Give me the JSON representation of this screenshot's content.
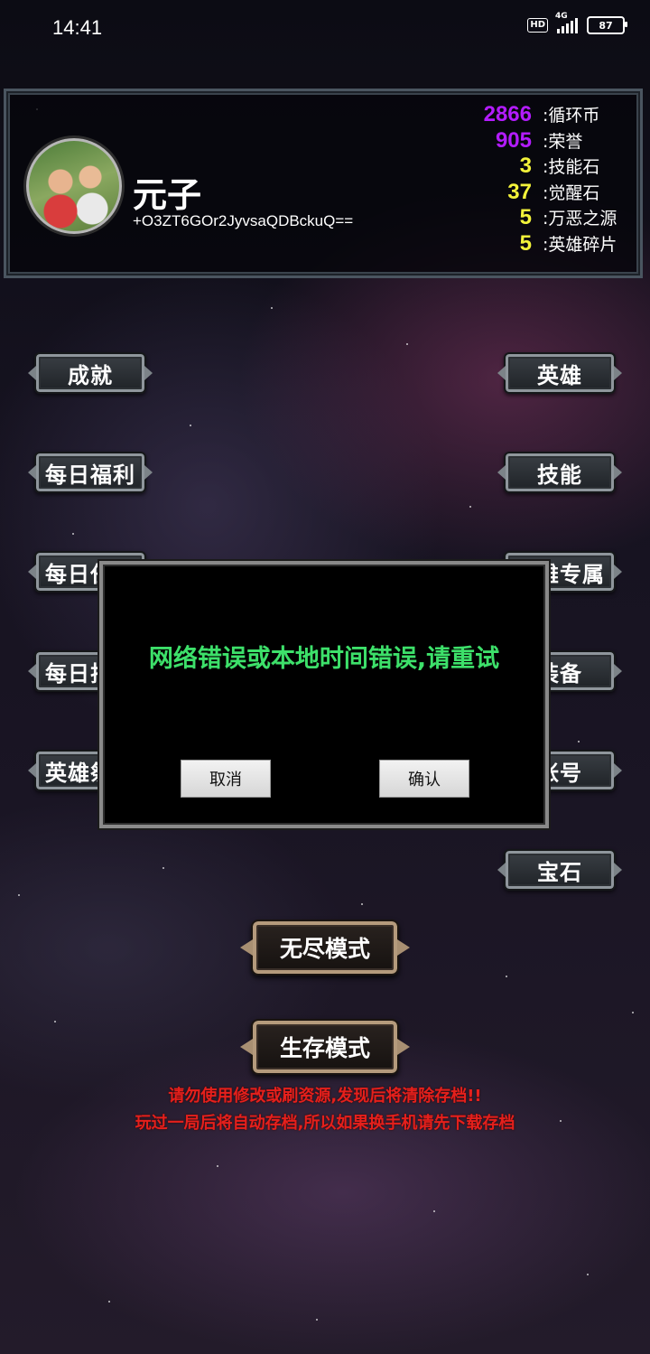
{
  "status_bar": {
    "time": "14:41",
    "hd_label": "HD",
    "network_label": "4G",
    "battery": "87"
  },
  "profile": {
    "name": "元子",
    "id": "+O3ZT6GOr2JyvsaQDBckuQ==",
    "resources": [
      {
        "value": "2866",
        "label": ":循环币",
        "color": "#b31cff"
      },
      {
        "value": "905",
        "label": ":荣誉",
        "color": "#b31cff"
      },
      {
        "value": "3",
        "label": ":技能石",
        "color": "#f3f33a"
      },
      {
        "value": "37",
        "label": ":觉醒石",
        "color": "#f3f33a"
      },
      {
        "value": "5",
        "label": ":万恶之源",
        "color": "#f3f33a"
      },
      {
        "value": "5",
        "label": ":英雄碎片",
        "color": "#f3f33a"
      }
    ]
  },
  "left_menu": {
    "achievements": "成就",
    "daily_welfare": "每日福利",
    "daily_tasks": "每日任务",
    "daily_ranking": "每日排行",
    "hero_altar": "英雄祭坛"
  },
  "right_menu": {
    "heroes": "英雄",
    "skills": "技能",
    "hero_exclusive": "英雄专属",
    "equipment": "装备",
    "account": "帐号",
    "gems": "宝石"
  },
  "modes": {
    "endless": "无尽模式",
    "survival": "生存模式"
  },
  "warnings": {
    "line1": "请勿使用修改或刷资源,发现后将清除存档!!",
    "line2": "玩过一局后将自动存档,所以如果换手机请先下载存档"
  },
  "dialog": {
    "message": "网络错误或本地时间错误,请重试",
    "cancel": "取消",
    "confirm": "确认"
  }
}
